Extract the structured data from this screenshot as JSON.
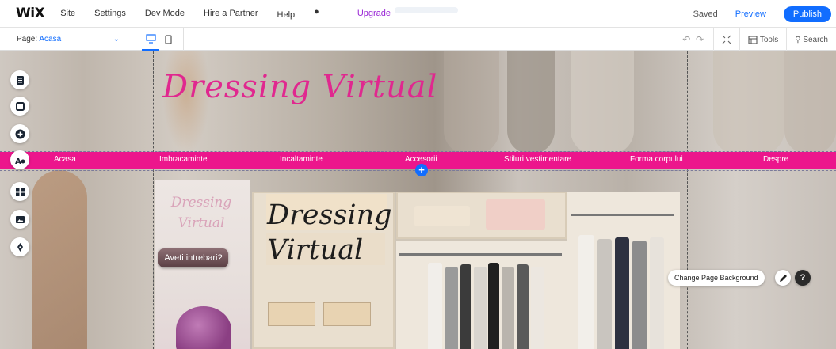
{
  "app": {
    "logo": "WiX"
  },
  "topnav": {
    "items": [
      "Site",
      "Settings",
      "Dev Mode",
      "Hire a Partner",
      "Help",
      "Upgrade"
    ],
    "saved": "Saved",
    "preview": "Preview",
    "publish": "Publish"
  },
  "toolbar": {
    "page_label": "Page:",
    "page_name": "Acasa",
    "tools": "Tools",
    "search": "Search"
  },
  "site": {
    "title": "Dressing Virtual",
    "menu": [
      "Acasa",
      "Imbracaminte",
      "Incaltaminte",
      "Accesorii",
      "Stiluri vestimentare",
      "Forma corpului",
      "Despre"
    ],
    "card_title_line1": "Dressing",
    "card_title_line2": "Virtual",
    "ask_button": "Aveti intrebari?",
    "wardrobe_title_line1": "Dressing",
    "wardrobe_title_line2": "Virtual"
  },
  "overlay": {
    "change_background": "Change Page Background",
    "help_glyph": "?"
  },
  "colors": {
    "wix_blue": "#116dff",
    "menu_pink": "#ec168c",
    "title_pink": "#e0288f"
  }
}
